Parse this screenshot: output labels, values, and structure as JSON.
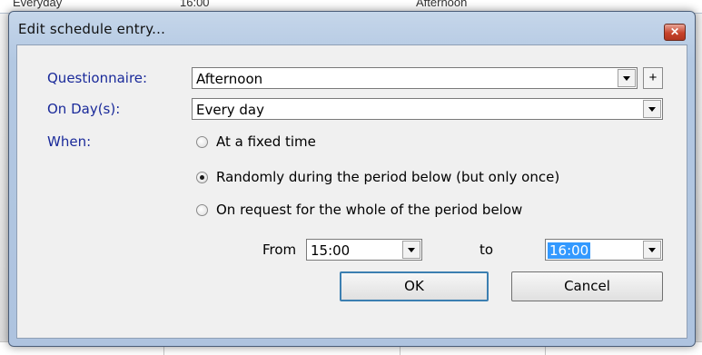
{
  "background": {
    "top_texts": [
      "Everyday",
      "16:00",
      "Afternoon"
    ]
  },
  "dialog": {
    "title": "Edit schedule entry...",
    "close_glyph": "✕",
    "questionnaire": {
      "label": "Questionnaire:",
      "value": "Afternoon",
      "add_label": "+"
    },
    "on_days": {
      "label": "On Day(s):",
      "value": "Every day"
    },
    "when": {
      "label": "When:",
      "options": [
        {
          "label": "At a fixed time",
          "checked": false
        },
        {
          "label": "Randomly during the period below (but only once)",
          "checked": true
        },
        {
          "label": "On request for the whole of the period below",
          "checked": false
        }
      ]
    },
    "period": {
      "from_label": "From",
      "from_value": "15:00",
      "to_label": "to",
      "to_value": "16:00"
    },
    "ok_label": "OK",
    "cancel_label": "Cancel"
  },
  "colors": {
    "label_text": "#1a2a9a",
    "selection": "#3399ff",
    "close_button": "#c7432b",
    "frame": "#b3c8e2"
  }
}
